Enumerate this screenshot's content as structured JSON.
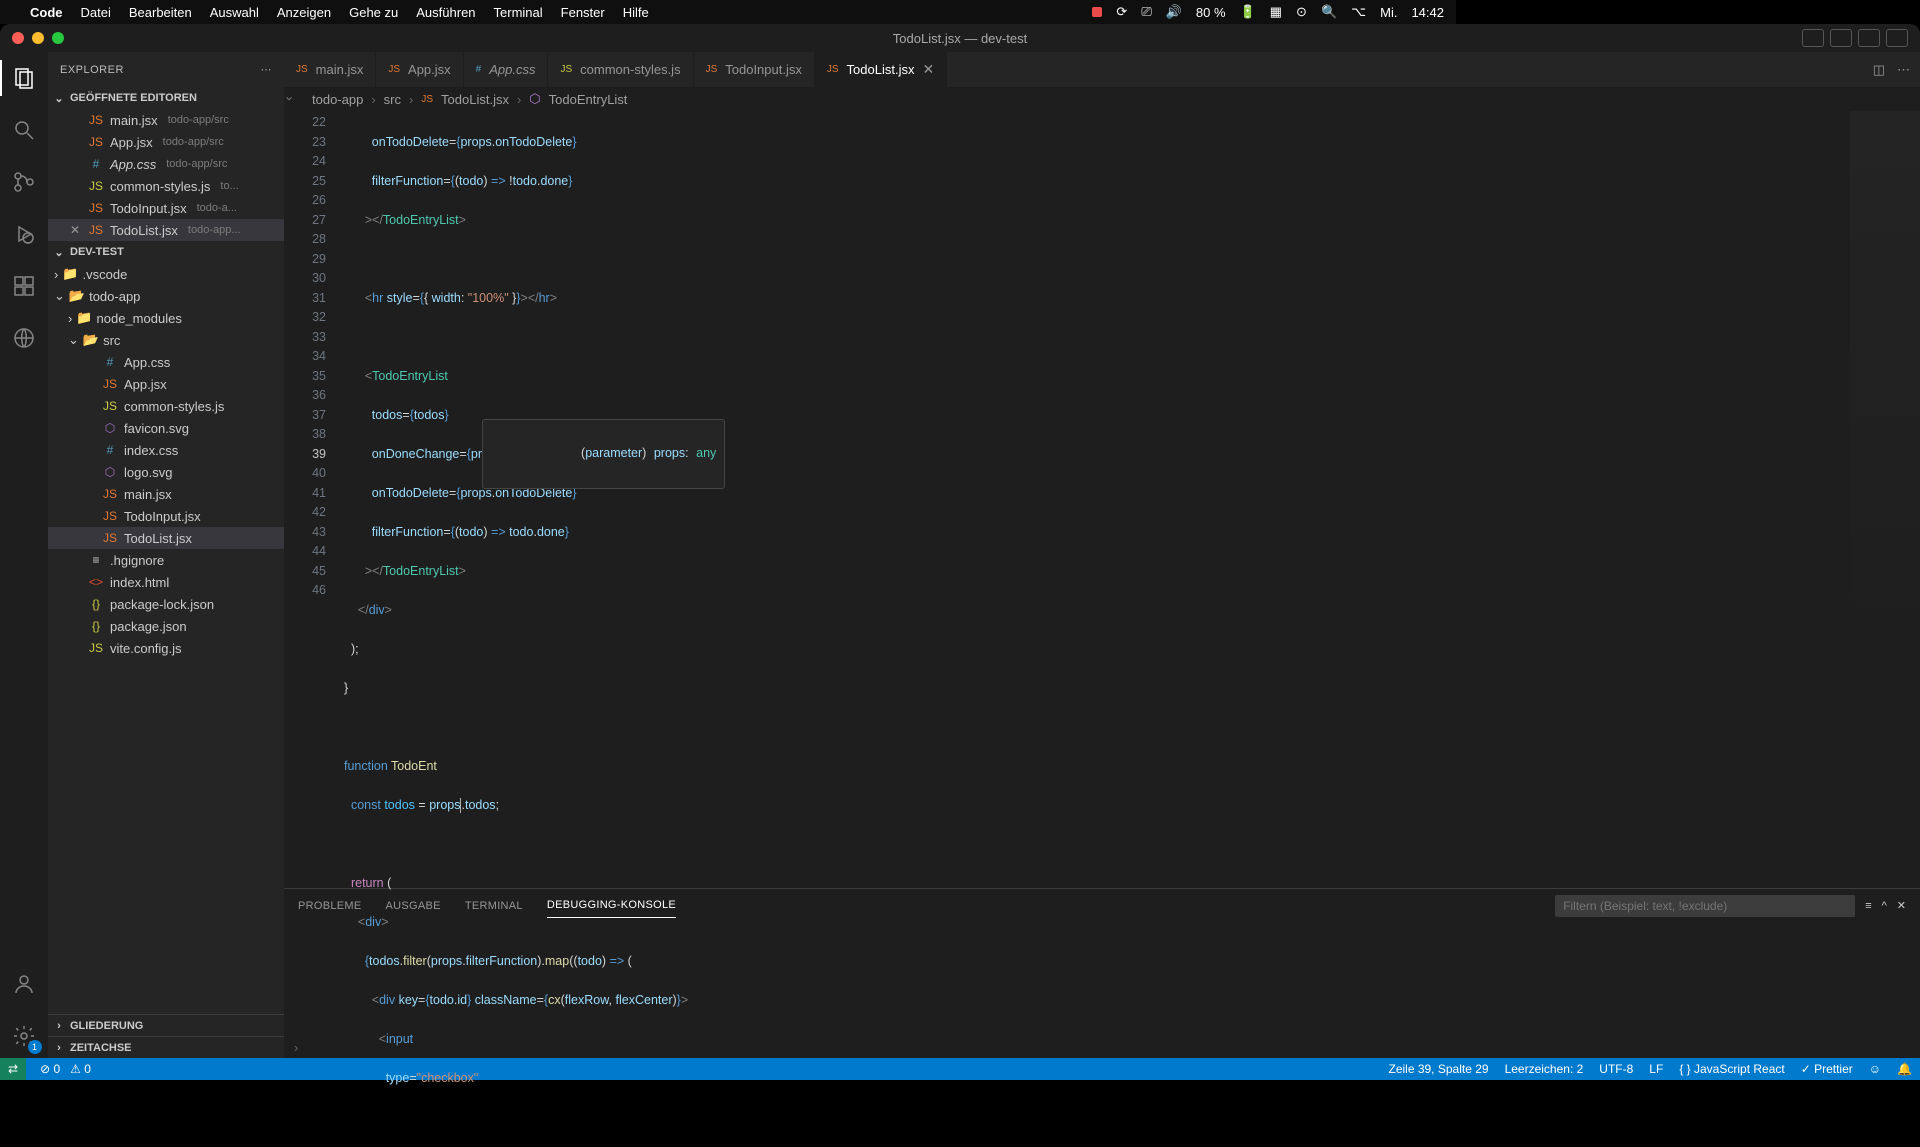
{
  "menubar": {
    "app": "Code",
    "items": [
      "Datei",
      "Bearbeiten",
      "Auswahl",
      "Anzeigen",
      "Gehe zu",
      "Ausführen",
      "Terminal",
      "Fenster",
      "Hilfe"
    ],
    "battery": "80 %",
    "day": "Mi.",
    "time": "14:42"
  },
  "window": {
    "title": "TodoList.jsx — dev-test"
  },
  "sidebar": {
    "title": "EXPLORER",
    "openEditorsTitle": "GEÖFFNETE EDITOREN",
    "openEditors": [
      {
        "name": "main.jsx",
        "path": "todo-app/src",
        "icon": "JS",
        "iconClass": "ficon-jsx"
      },
      {
        "name": "App.jsx",
        "path": "todo-app/src",
        "icon": "JS",
        "iconClass": "ficon-jsx"
      },
      {
        "name": "App.css",
        "path": "todo-app/src",
        "icon": "#",
        "iconClass": "ficon-css",
        "italic": true
      },
      {
        "name": "common-styles.js",
        "path": "to...",
        "icon": "JS",
        "iconClass": "ficon-js"
      },
      {
        "name": "TodoInput.jsx",
        "path": "todo-a...",
        "icon": "JS",
        "iconClass": "ficon-jsx"
      },
      {
        "name": "TodoList.jsx",
        "path": "todo-app...",
        "icon": "JS",
        "iconClass": "ficon-jsx",
        "active": true
      }
    ],
    "projectTitle": "DEV-TEST",
    "outlineTitle": "GLIEDERUNG",
    "timelineTitle": "ZEITACHSE",
    "tree": {
      "vscode": ".vscode",
      "todoapp": "todo-app",
      "nodemodules": "node_modules",
      "src": "src",
      "files": [
        {
          "name": "App.css",
          "icon": "#",
          "iconClass": "ficon-css"
        },
        {
          "name": "App.jsx",
          "icon": "JS",
          "iconClass": "ficon-jsx"
        },
        {
          "name": "common-styles.js",
          "icon": "JS",
          "iconClass": "ficon-js"
        },
        {
          "name": "favicon.svg",
          "icon": "⬡",
          "iconClass": "ficon-svg"
        },
        {
          "name": "index.css",
          "icon": "#",
          "iconClass": "ficon-css"
        },
        {
          "name": "logo.svg",
          "icon": "⬡",
          "iconClass": "ficon-svg"
        },
        {
          "name": "main.jsx",
          "icon": "JS",
          "iconClass": "ficon-jsx"
        },
        {
          "name": "TodoInput.jsx",
          "icon": "JS",
          "iconClass": "ficon-jsx"
        },
        {
          "name": "TodoList.jsx",
          "icon": "JS",
          "iconClass": "ficon-jsx",
          "sel": true
        }
      ],
      "rootFiles": [
        {
          "name": ".hgignore",
          "icon": "≡",
          "iconClass": ""
        },
        {
          "name": "index.html",
          "icon": "<>",
          "iconClass": "ficon-html"
        },
        {
          "name": "package-lock.json",
          "icon": "{}",
          "iconClass": "ficon-json"
        },
        {
          "name": "package.json",
          "icon": "{}",
          "iconClass": "ficon-json"
        },
        {
          "name": "vite.config.js",
          "icon": "JS",
          "iconClass": "ficon-js"
        }
      ]
    }
  },
  "tabs": [
    {
      "label": "main.jsx",
      "icon": "JS",
      "iconClass": "ficon-jsx"
    },
    {
      "label": "App.jsx",
      "icon": "JS",
      "iconClass": "ficon-jsx"
    },
    {
      "label": "App.css",
      "icon": "#",
      "iconClass": "ficon-css",
      "italic": true
    },
    {
      "label": "common-styles.js",
      "icon": "JS",
      "iconClass": "ficon-js"
    },
    {
      "label": "TodoInput.jsx",
      "icon": "JS",
      "iconClass": "ficon-jsx"
    },
    {
      "label": "TodoList.jsx",
      "icon": "JS",
      "iconClass": "ficon-jsx",
      "active": true
    }
  ],
  "breadcrumb": {
    "a": "todo-app",
    "b": "src",
    "c": "TodoList.jsx",
    "d": "TodoEntryList"
  },
  "hover": {
    "text": "(parameter) props: any"
  },
  "panel": {
    "tabs": {
      "a": "PROBLEME",
      "b": "AUSGABE",
      "c": "TERMINAL",
      "d": "DEBUGGING-KONSOLE"
    },
    "filterPlaceholder": "Filtern (Beispiel: text, !exclude)"
  },
  "statusbar": {
    "errors": "0",
    "warnings": "0",
    "pos": "Zeile 39, Spalte 29",
    "spaces": "Leerzeichen: 2",
    "encoding": "UTF-8",
    "eol": "LF",
    "lang": "JavaScript React",
    "prettier": "Prettier"
  },
  "code": {
    "startLine": 22,
    "currentLine": 39
  }
}
